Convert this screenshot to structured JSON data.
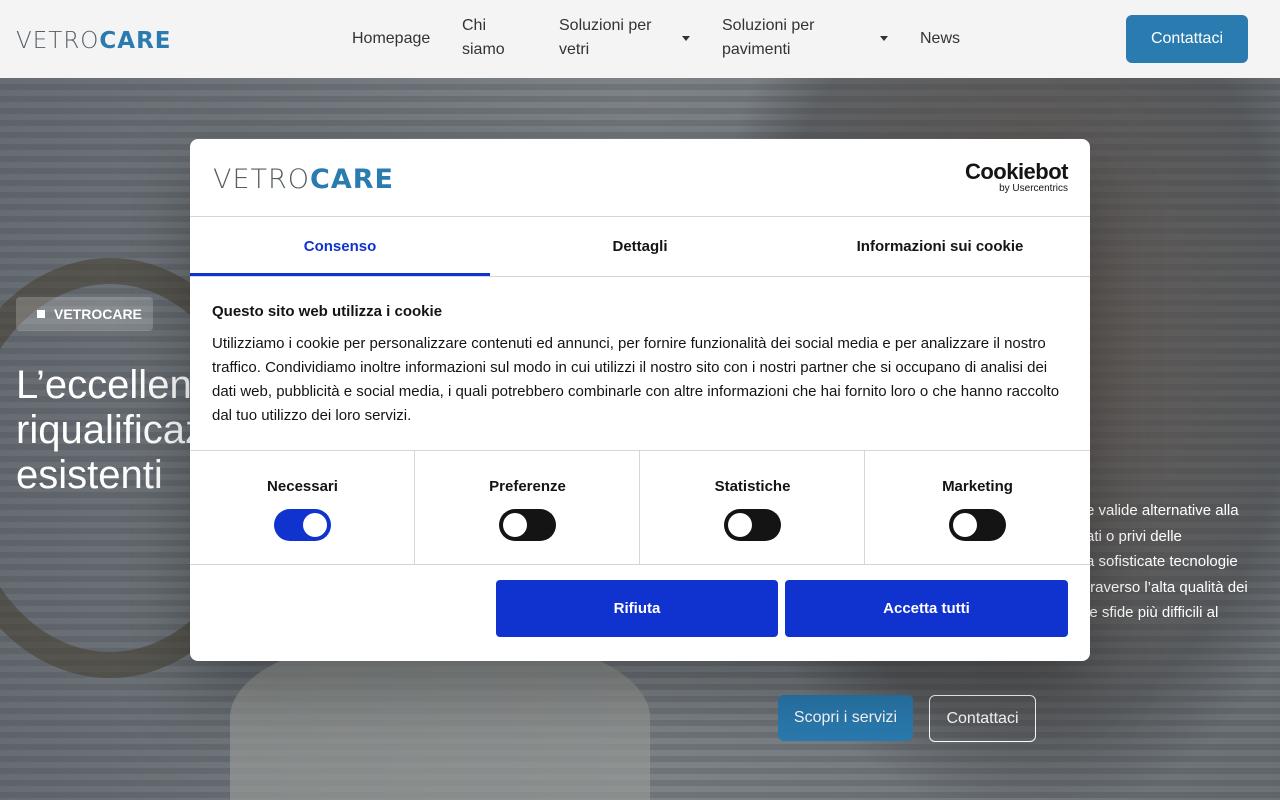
{
  "header": {
    "logo_light": "VETRO",
    "logo_bold": "CARE",
    "nav": {
      "homepage": "Homepage",
      "chi_siamo": "Chi\nsiamo",
      "soluzioni_vetri": "Soluzioni per\nvetri",
      "soluzioni_pavimenti": "Soluzioni per\npavimenti",
      "news": "News"
    },
    "cta": "Contattaci"
  },
  "hero": {
    "badge": "VETROCARE",
    "title": "L’eccellenza nella\nriqualificazione di vetri\nesistenti",
    "text": "e valide alternative alla\nati o privi delle\na sofisticate tecnologie\ntraverso l’alta qualità dei\n le sfide più difficili al",
    "btn_primary": "Scopri i servizi",
    "btn_secondary": "Contattaci"
  },
  "cookie_dialog": {
    "logo_light": "VETRO",
    "logo_bold": "CARE",
    "provider_main": "Cookiebot",
    "provider_sub": "by Usercentrics",
    "tabs": [
      "Consenso",
      "Dettagli",
      "Informazioni sui cookie"
    ],
    "active_tab": "Consenso",
    "heading": "Questo sito web utilizza i cookie",
    "body": "Utilizziamo i cookie per personalizzare contenuti ed annunci, per fornire funzionalità dei social media e per analizzare il nostro traffico. Condividiamo inoltre informazioni sul modo in cui utilizzi il nostro sito con i nostri partner che si occupano di analisi dei dati web, pubblicità e social media, i quali potrebbero combinarle con altre informazioni che hai fornito loro o che hanno raccolto dal tuo utilizzo dei loro servizi.",
    "categories": [
      {
        "label": "Necessari",
        "enabled": true
      },
      {
        "label": "Preferenze",
        "enabled": false
      },
      {
        "label": "Statistiche",
        "enabled": false
      },
      {
        "label": "Marketing",
        "enabled": false
      }
    ],
    "deny_label": "Rifiuta",
    "accept_label": "Accetta tutti"
  },
  "colors": {
    "brand_blue": "#2a7bb0",
    "cookiebot_blue": "#1032cf"
  }
}
